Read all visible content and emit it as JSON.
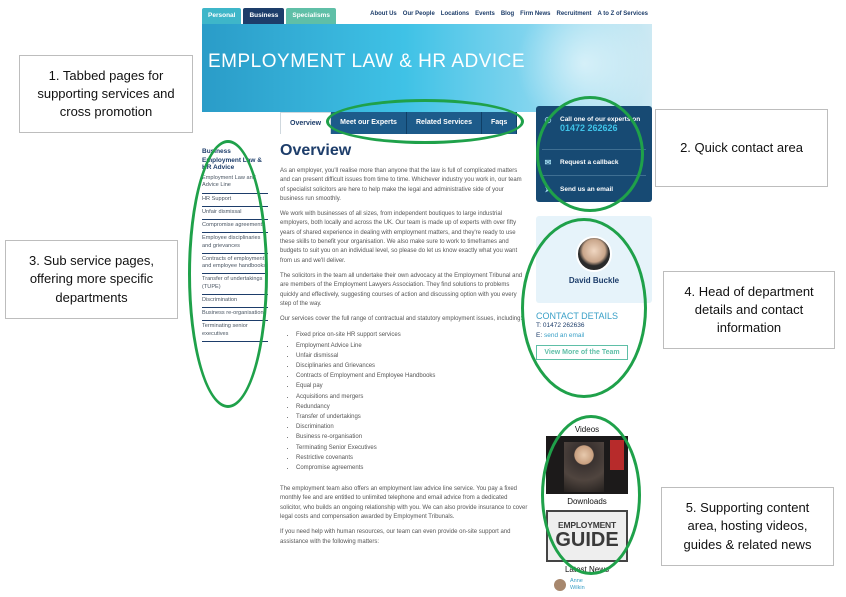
{
  "site": {
    "segment_tabs": [
      "Personal",
      "Business",
      "Specialisms"
    ],
    "top_nav": [
      "About Us",
      "Our People",
      "Locations",
      "Events",
      "Blog",
      "Firm News",
      "Recruitment",
      "A to Z of Services"
    ],
    "hero_title": "EMPLOYMENT LAW & HR ADVICE",
    "page_tabs": [
      "Overview",
      "Meet our Experts",
      "Related Services",
      "Faqs"
    ],
    "sidebar": {
      "heading": "Business",
      "subheading": "Employment Law & HR Advice",
      "items": [
        "Employment Law and Advice Line",
        "HR Support",
        "Unfair dismissal",
        "Compromise agreements",
        "Employee disciplinaries and grievances",
        "Contracts of employment and employee handbooks",
        "Transfer of undertakings (TUPE)",
        "Discrimination",
        "Business re-organisation",
        "Terminating senior executives"
      ]
    },
    "content": {
      "title": "Overview",
      "p1": "As an employer, you'll realise more than anyone that the law is full of complicated matters and can present difficult issues from time to time. Whichever industry you work in, our team of specialist solicitors are here to help make the legal and administrative side of your business run smoothly.",
      "p2": "We work with businesses of all sizes, from independent boutiques to large industrial employers, both locally and across the UK. Our team is made up of experts with over fifty years of shared experience in dealing with employment matters, and they're ready to use these skills to benefit your organisation. We also make sure to work to timeframes and budgets to suit you on an individual level, so please do let us know exactly what you want from us and we'll deliver.",
      "p3": "The solicitors in the team all undertake their own advocacy at the Employment Tribunal and are members of the Employment Lawyers Association. They find solutions to problems quickly and effectively, suggesting courses of action and discussing option with you every step of the way.",
      "p4": "Our services cover the full range of contractual and statutory employment issues, including:",
      "list": [
        "Fixed price on-site HR support services",
        "Employment Advice Line",
        "Unfair dismissal",
        "Disciplinaries and Grievances",
        "Contracts of Employment and Employee Handbooks",
        "Equal pay",
        "Acquisitions and mergers",
        "Redundancy",
        "Transfer of undertakings",
        "Discrimination",
        "Business re-organisation",
        "Terminating Senior Executives",
        "Restrictive covenants",
        "Compromise agreements"
      ],
      "p5": "The employment team also offers an employment law advice line service. You pay a fixed monthly fee and are entitled to unlimited telephone and email advice from a dedicated solicitor, who builds an ongoing relationship with you. We can also provide insurance to cover legal costs and compensation awarded by Employment Tribunals.",
      "p6": "If you need help with human resources, our team can even provide on-site support and assistance with the following matters:"
    },
    "contact_box": {
      "call_label": "Call one of our experts on",
      "phone": "01472 262626",
      "callback": "Request a callback",
      "email": "Send us an email"
    },
    "team": {
      "name": "David Buckle",
      "contact_heading": "CONTACT DETAILS",
      "t_label": "T:",
      "t_value": "01472 262636",
      "e_label": "E:",
      "e_value": "send an email",
      "button": "View More of the Team"
    },
    "media": {
      "videos_label": "Videos",
      "downloads_label": "Downloads",
      "guide_line1": "EMPLOYMENT",
      "guide_line2": "GUIDE",
      "news_label": "Latest News",
      "news_author_1": "Anne",
      "news_author_2": "Wilkin"
    }
  },
  "callouts": [
    "1. Tabbed pages for supporting services and cross promotion",
    "2. Quick contact area",
    "3. Sub service pages, offering more specific departments",
    "4. Head of department details and contact information",
    "5. Supporting content area, hosting videos, guides & related news"
  ],
  "colors": {
    "annotation_green": "#1fa14a",
    "navy": "#1d3d6a",
    "hero_blue": "#3fc2e6",
    "accent_teal": "#5fbfa7"
  }
}
